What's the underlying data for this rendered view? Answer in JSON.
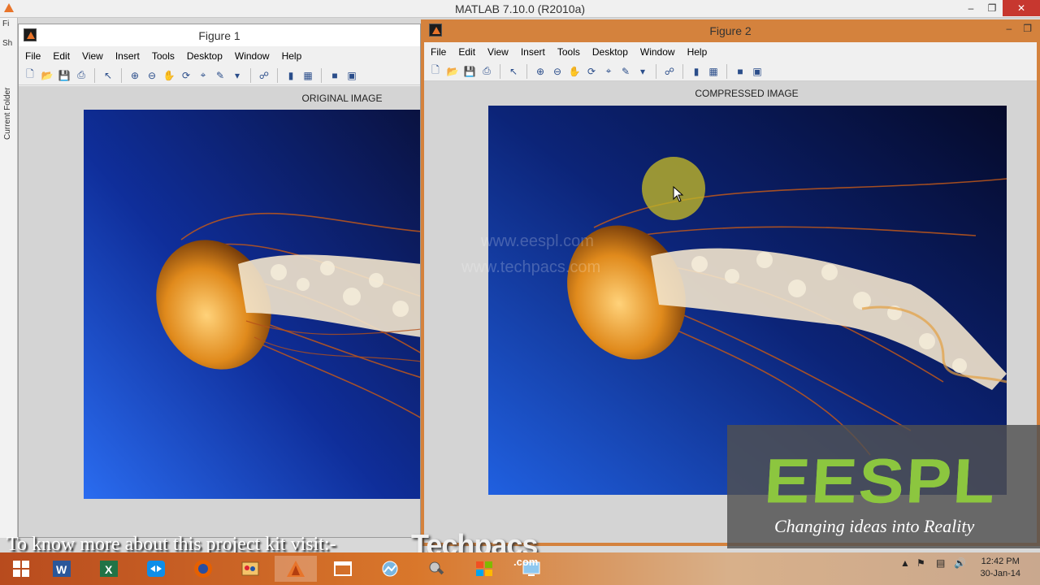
{
  "main_window": {
    "title": "MATLAB  7.10.0 (R2010a)",
    "minimize_icon": "minimize-icon",
    "maximize_icon": "maximize-icon",
    "close_icon": "close-icon",
    "side_labels": [
      "Fi",
      "Sh"
    ],
    "side_panel_title": "Current Folder"
  },
  "figure1": {
    "title": "Figure 1",
    "menu": [
      "File",
      "Edit",
      "View",
      "Insert",
      "Tools",
      "Desktop",
      "Window",
      "Help"
    ],
    "axes_title": "ORIGINAL IMAGE"
  },
  "figure2": {
    "title": "Figure 2",
    "menu": [
      "File",
      "Edit",
      "View",
      "Insert",
      "Tools",
      "Desktop",
      "Window",
      "Help"
    ],
    "axes_title": "COMPRESSED IMAGE",
    "watermark_lines": [
      "www.eespl.com",
      "www.techpacs.com"
    ]
  },
  "overlay": {
    "logo_text": "EESPL",
    "tagline": "Changing ideas into Reality",
    "logo_color": "#8cc63f"
  },
  "banner": {
    "text": "To know more about this project kit visit:-",
    "brand": "Techpacs",
    "brand_suffix": ".com"
  },
  "taskbar": {
    "apps": [
      "windows-start-icon",
      "word-icon",
      "excel-icon",
      "teamviewer-icon",
      "firefox-icon",
      "paint-icon",
      "matlab-icon",
      "window-icon",
      "photos-icon",
      "tools-icon",
      "store-icon",
      "desktop-icon"
    ],
    "time": "12:42 PM",
    "date": "30-Jan-14"
  },
  "colors": {
    "figure2_frame": "#d4823d",
    "jelly_orange": "#e08a1c",
    "ocean_deep": "#0a1240",
    "ocean_light": "#1e5ad8"
  }
}
